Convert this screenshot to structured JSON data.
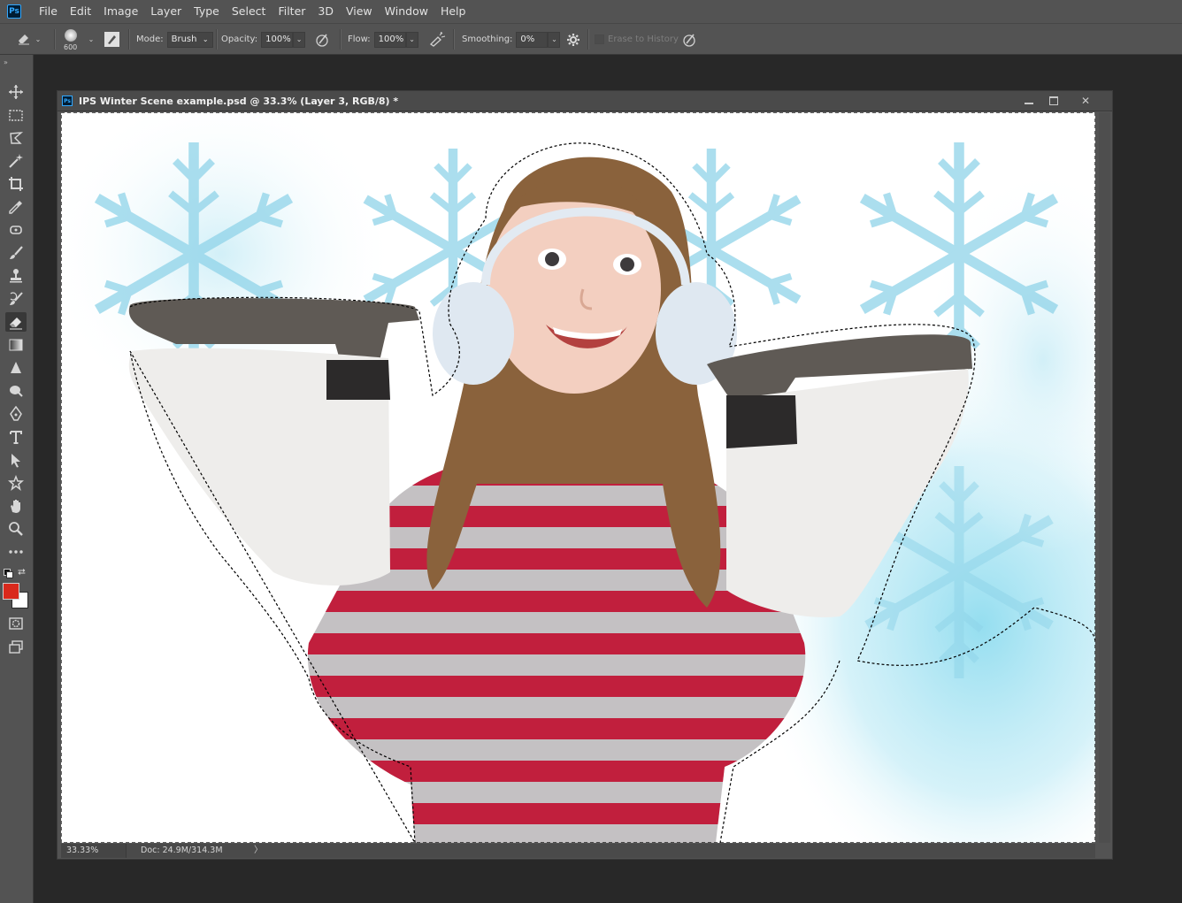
{
  "app": {
    "logo": "Ps"
  },
  "menu": [
    "File",
    "Edit",
    "Image",
    "Layer",
    "Type",
    "Select",
    "Filter",
    "3D",
    "View",
    "Window",
    "Help"
  ],
  "options": {
    "tool_icon": "eraser-icon",
    "brush_size": "600",
    "mode_label": "Mode:",
    "mode_value": "Brush",
    "opacity_label": "Opacity:",
    "opacity_value": "100%",
    "flow_label": "Flow:",
    "flow_value": "100%",
    "smoothing_label": "Smoothing:",
    "smoothing_value": "0%",
    "erase_to_history": "Erase to History"
  },
  "document": {
    "title": "IPS Winter Scene example.psd @ 33.3% (Layer 3, RGB/8) *",
    "zoom": "33.33%",
    "doc_info": "Doc: 24.9M/314.3M",
    "status_arrow": "〉"
  },
  "colors": {
    "foreground": "#d9291c",
    "background": "#ffffff",
    "ui_dark": "#535353",
    "workspace": "#282828"
  },
  "tools": [
    "move-tool-icon",
    "marquee-tool-icon",
    "lasso-tool-icon",
    "magic-wand-icon",
    "crop-tool-icon",
    "eyedropper-icon",
    "spot-healing-icon",
    "brush-tool-icon",
    "clone-stamp-icon",
    "history-brush-icon",
    "eraser-tool-icon",
    "gradient-tool-icon",
    "blur-tool-icon",
    "dodge-tool-icon",
    "pen-tool-icon",
    "type-tool-icon",
    "path-selection-icon",
    "shape-tool-icon",
    "hand-tool-icon",
    "zoom-tool-icon",
    "more-tools-icon"
  ]
}
